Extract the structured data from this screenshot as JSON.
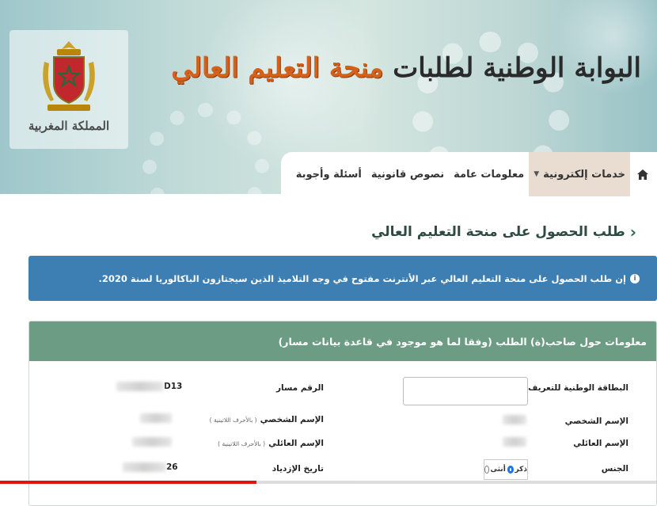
{
  "logo": {
    "caption": "المملكة المغربية"
  },
  "site_title": {
    "part1": "البوابة الوطنية لطلبات",
    "part2": "منحة التعليم العالي"
  },
  "nav": {
    "home_icon": "home-icon",
    "items": [
      {
        "label": "خدمات إلكترونية",
        "active": true,
        "has_caret": true
      },
      {
        "label": "معلومات عامة"
      },
      {
        "label": "نصوص قانونية"
      },
      {
        "label": "أسئلة وأجوبة"
      }
    ]
  },
  "page": {
    "heading": "طلب الحصول على منحة التعليم العالي"
  },
  "alert": {
    "text": "إن طلب الحصول على منحة التعليم العالي عبر الأنترنت مفتوح في وجه التلاميذ الذين سيجتازون الباكالوريا لسنة 2020."
  },
  "panel": {
    "header": "معلومات حول صاحب(ة) الطلب (وفقا لما هو موجود في قاعدة بيانات مسار)",
    "fields": {
      "cin_label": "البطاقة الوطنية للتعريف",
      "massar_label": "الرقم مسار",
      "massar_value": "D13",
      "first_name_label": "الإسم الشخصي",
      "first_name_latin_label": "الإسم الشخصي",
      "first_name_latin_hint": "( بالأحرف اللاتينية )",
      "last_name_label": "الإسم العائلي",
      "last_name_latin_label": "الإسم العائلي",
      "last_name_latin_hint": "( بالأحرف اللاتينية )",
      "gender_label": "الجنس",
      "gender_male": "ذكر",
      "gender_female": "أنثى",
      "birth_date_label": "تاريخ الإزدياد",
      "birth_date_value": "26"
    }
  },
  "video": {
    "played_fraction": 0.39,
    "buffered_fraction": 0.54
  }
}
